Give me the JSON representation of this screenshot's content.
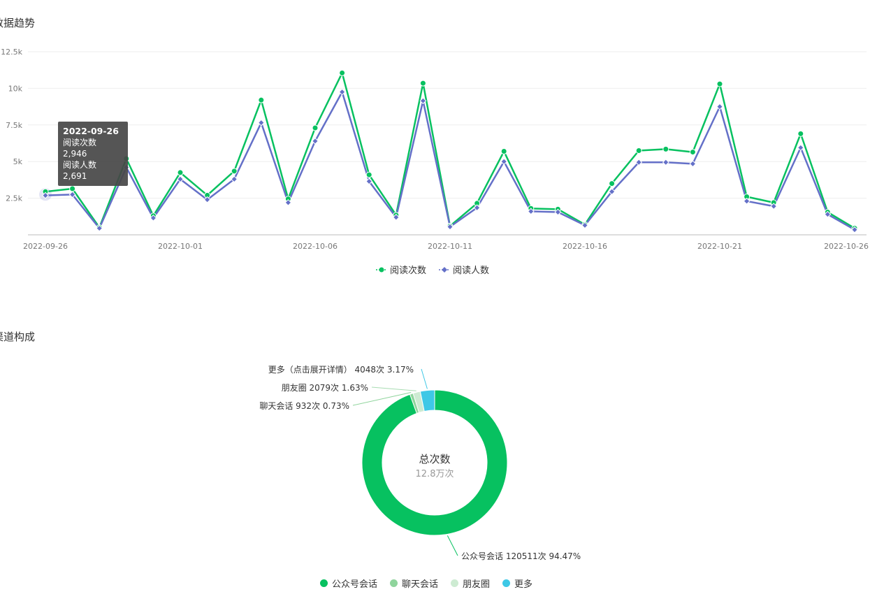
{
  "trend": {
    "title": "数据趋势",
    "tooltip": {
      "date": "2022-09-26",
      "rows": [
        {
          "label": "阅读次数",
          "value": "2,946"
        },
        {
          "label": "阅读人数",
          "value": "2,691"
        }
      ]
    }
  },
  "channel": {
    "title": "渠道构成",
    "center_label": "总次数",
    "center_value": "12.8万次"
  },
  "colors": {
    "green": "#07c160",
    "blue": "#6470c8",
    "light_green": "#8fd49c",
    "pale_green": "#cdebd2",
    "cyan": "#3ec8e6"
  },
  "chart_data": [
    {
      "type": "line",
      "x": [
        "2022-09-26",
        "2022-09-27",
        "2022-09-28",
        "2022-09-29",
        "2022-09-30",
        "2022-10-01",
        "2022-10-02",
        "2022-10-03",
        "2022-10-04",
        "2022-10-05",
        "2022-10-06",
        "2022-10-07",
        "2022-10-08",
        "2022-10-09",
        "2022-10-10",
        "2022-10-11",
        "2022-10-12",
        "2022-10-13",
        "2022-10-14",
        "2022-10-15",
        "2022-10-16",
        "2022-10-17",
        "2022-10-18",
        "2022-10-19",
        "2022-10-20",
        "2022-10-21",
        "2022-10-22",
        "2022-10-23",
        "2022-10-24",
        "2022-10-25",
        "2022-10-26"
      ],
      "x_tick_labels": [
        "2022-09-26",
        "2022-10-01",
        "2022-10-06",
        "2022-10-11",
        "2022-10-16",
        "2022-10-21",
        "2022-10-26"
      ],
      "y_tick_labels": [
        "2.5k",
        "5k",
        "7.5k",
        "10k",
        "12.5k"
      ],
      "ylim": [
        0,
        12500
      ],
      "grid": true,
      "legend_position": "bottom",
      "series": [
        {
          "name": "阅读次数",
          "color": "#07c160",
          "marker": "circle",
          "values": [
            2946,
            3150,
            500,
            5200,
            1300,
            4250,
            2700,
            4350,
            9200,
            2450,
            7300,
            11050,
            4100,
            1350,
            10350,
            600,
            2150,
            5700,
            1800,
            1750,
            700,
            3500,
            5750,
            5850,
            5650,
            10300,
            2600,
            2200,
            6900,
            1550,
            450
          ]
        },
        {
          "name": "阅读人数",
          "color": "#6470c8",
          "marker": "diamond",
          "values": [
            2691,
            2750,
            450,
            4600,
            1150,
            3800,
            2400,
            3800,
            7650,
            2200,
            6400,
            9750,
            3650,
            1200,
            9150,
            550,
            1850,
            5000,
            1600,
            1550,
            650,
            2950,
            4950,
            4950,
            4850,
            8750,
            2300,
            1950,
            5950,
            1400,
            350
          ]
        }
      ]
    },
    {
      "type": "pie",
      "donut": true,
      "legend_position": "bottom",
      "slices": [
        {
          "name": "公众号会话",
          "count": 120511,
          "percent": 94.47,
          "label": "公众号会话 120511次 94.47%",
          "color": "#07c160"
        },
        {
          "name": "聊天会话",
          "count": 932,
          "percent": 0.73,
          "label": "聊天会话 932次 0.73%",
          "color": "#8fd49c"
        },
        {
          "name": "朋友圈",
          "count": 2079,
          "percent": 1.63,
          "label": "朋友圈 2079次 1.63%",
          "color": "#cdebd2"
        },
        {
          "name": "更多",
          "count": 4048,
          "percent": 3.17,
          "label": "更多（点击展开详情） 4048次 3.17%",
          "color": "#3ec8e6"
        }
      ]
    }
  ]
}
